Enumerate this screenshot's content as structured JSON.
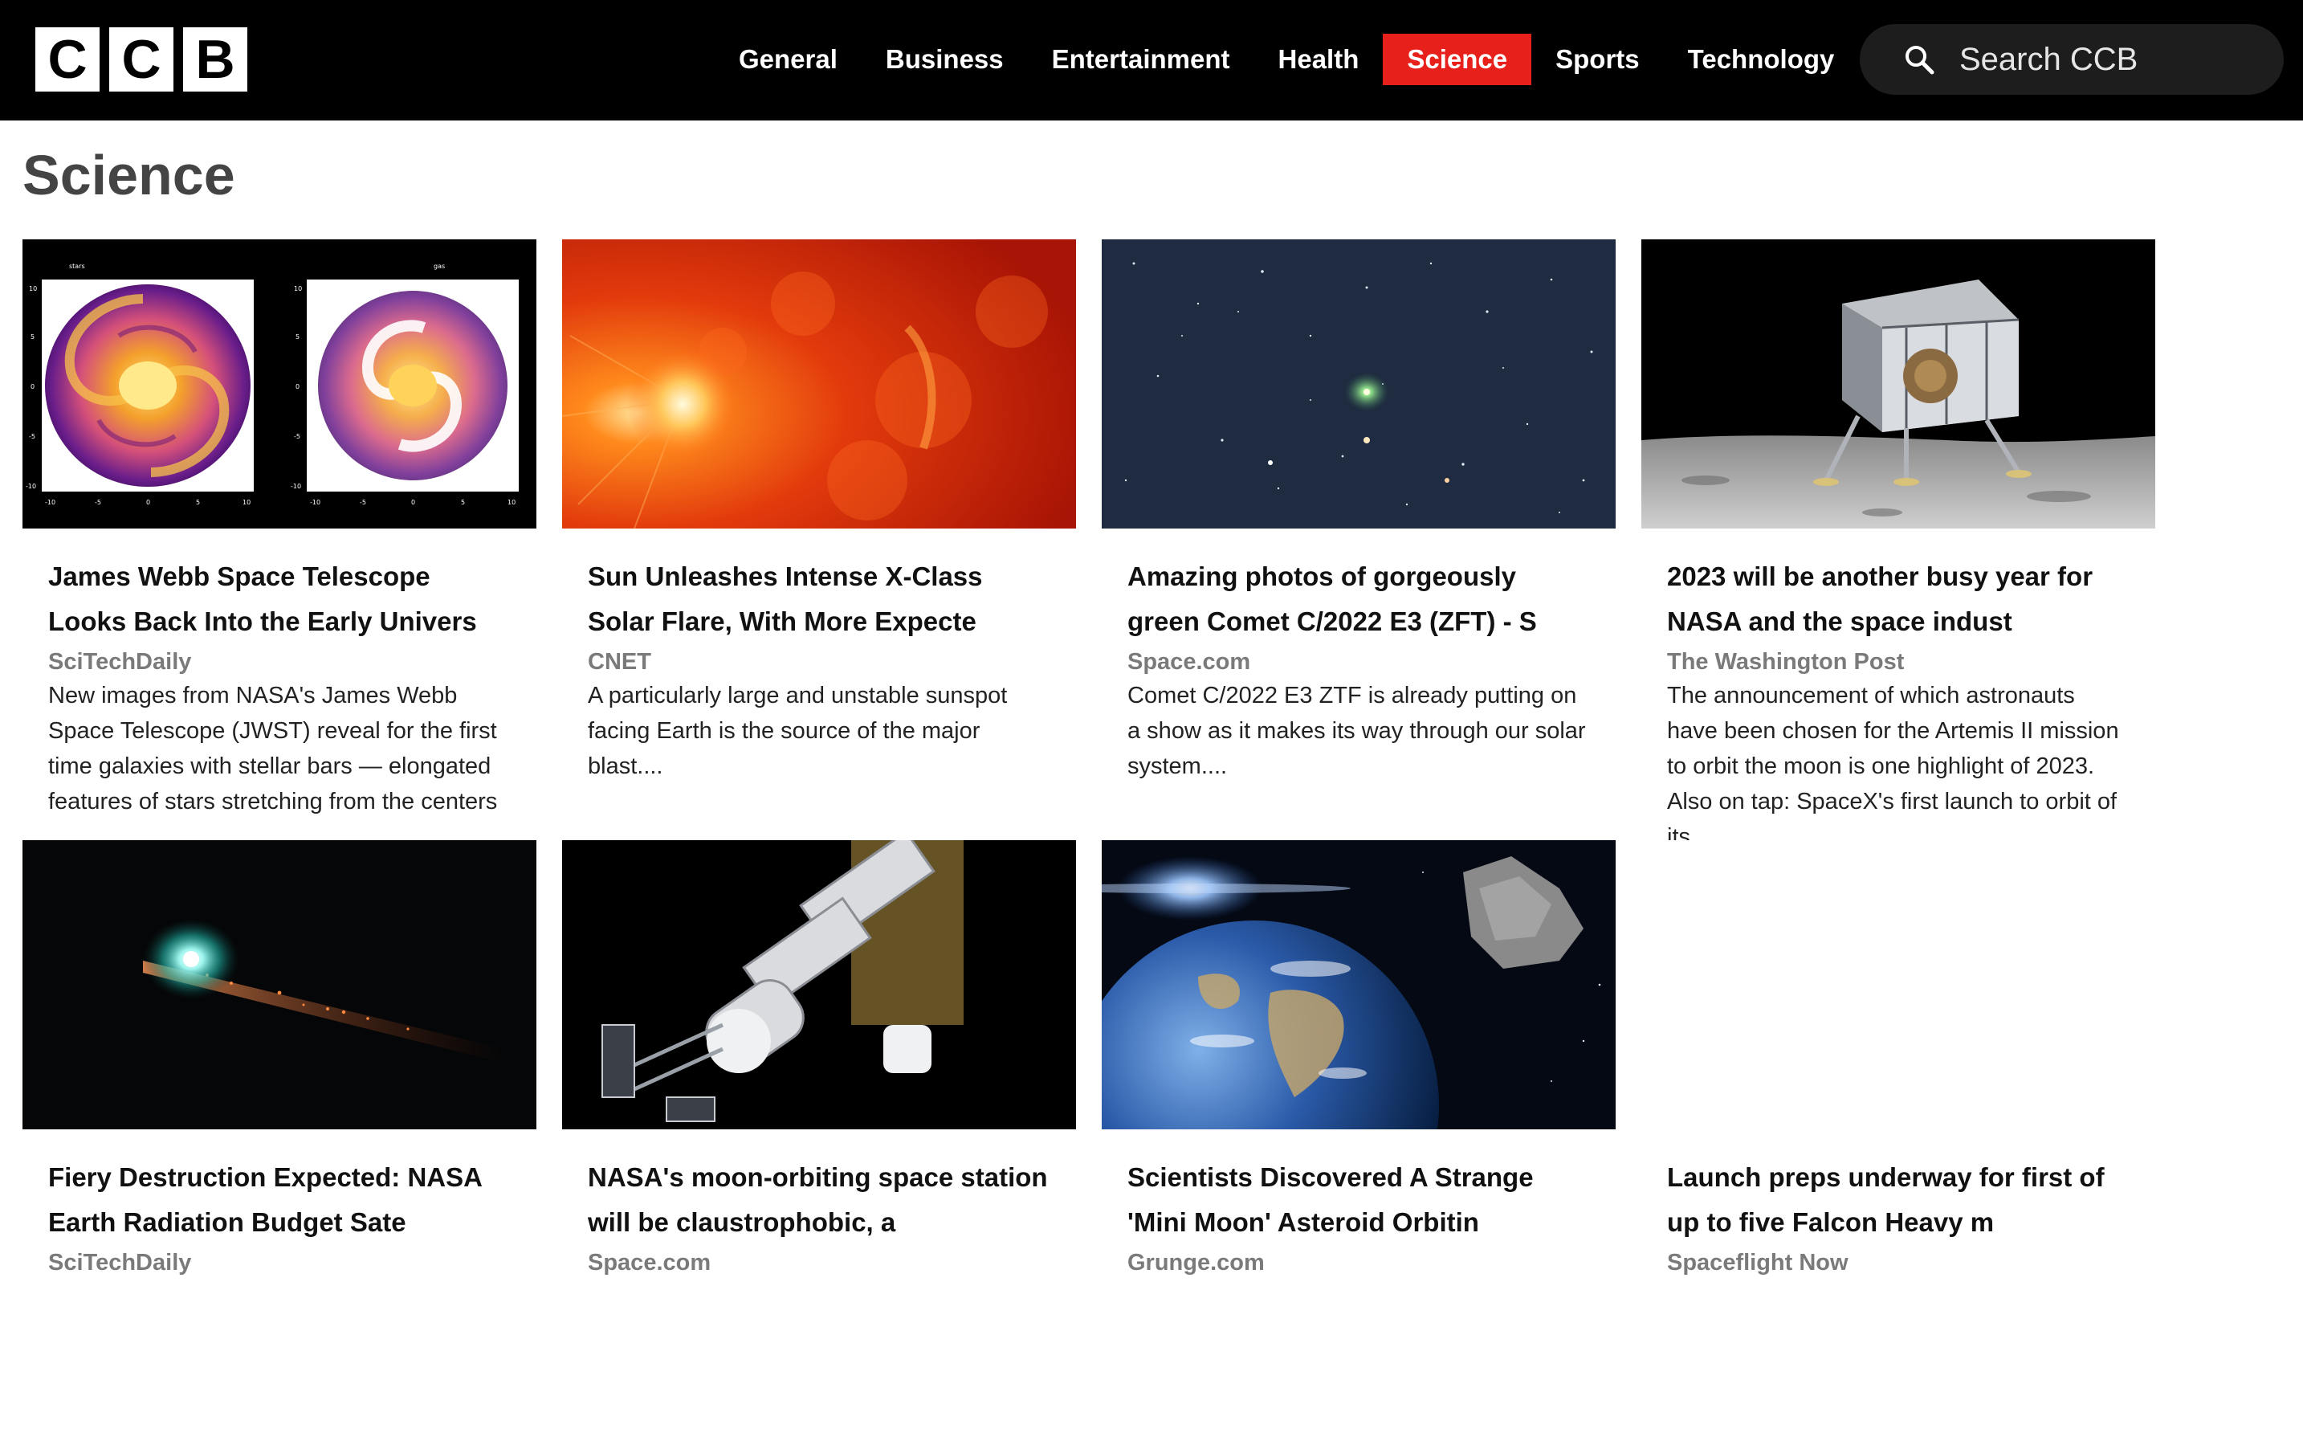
{
  "header": {
    "logo_letters": [
      "C",
      "C",
      "B"
    ],
    "nav": [
      {
        "label": "General",
        "active": false
      },
      {
        "label": "Business",
        "active": false
      },
      {
        "label": "Entertainment",
        "active": false
      },
      {
        "label": "Health",
        "active": false
      },
      {
        "label": "Science",
        "active": true
      },
      {
        "label": "Sports",
        "active": false
      },
      {
        "label": "Technology",
        "active": false
      }
    ],
    "search_placeholder": "Search CCB",
    "search_icon": "search-icon",
    "active_color": "#e8201b"
  },
  "page": {
    "title": "Science"
  },
  "articles": [
    {
      "title": "James Webb Space Telescope Looks Back Into the Early Univers",
      "source": "SciTechDaily",
      "description": "New images from NASA's James Webb Space Telescope (JWST) reveal for the first time galaxies with stellar bars — elongated features of stars stretching from the centers",
      "image": "galaxy-plots",
      "thumb_labels": {
        "left_panel_title": "stars",
        "right_panel_title": "gas",
        "x_ticks": [
          "-10",
          "-5",
          "0",
          "5",
          "10"
        ],
        "y_ticks": [
          "10",
          "5",
          "0",
          "-5",
          "-10"
        ]
      }
    },
    {
      "title": "Sun Unleashes Intense X-Class Solar Flare, With More Expecte",
      "source": "CNET",
      "description": "A particularly large and unstable sunspot facing Earth is the source of the major blast....",
      "image": "solar-flare"
    },
    {
      "title": "Amazing photos of gorgeously green Comet C/2022 E3 (ZFT) - S",
      "source": "Space.com",
      "description": "Comet C/2022 E3 ZTF is already putting on a show as it makes its way through our solar system....",
      "image": "green-comet"
    },
    {
      "title": "2023 will be another busy year for NASA and the space indust",
      "source": "The Washington Post",
      "description": "The announcement of which astronauts have been chosen for the Artemis II mission to orbit the moon is one highlight of 2023. Also on tap: SpaceX's first launch to orbit of its",
      "image": "lunar-lander"
    },
    {
      "title": "Fiery Destruction Expected: NASA Earth Radiation Budget Sate",
      "source": "SciTechDaily",
      "description": "",
      "image": "satellite-reentry"
    },
    {
      "title": "NASA's moon-orbiting space station will be claustrophobic, a",
      "source": "Space.com",
      "description": "",
      "image": "space-station"
    },
    {
      "title": "Scientists Discovered A Strange 'Mini Moon' Asteroid Orbitin",
      "source": "Grunge.com",
      "description": "",
      "image": "earth-asteroid"
    },
    {
      "title": "Launch preps underway for first of up to five Falcon Heavy m",
      "source": "Spaceflight Now",
      "description": "",
      "image": "none"
    }
  ]
}
